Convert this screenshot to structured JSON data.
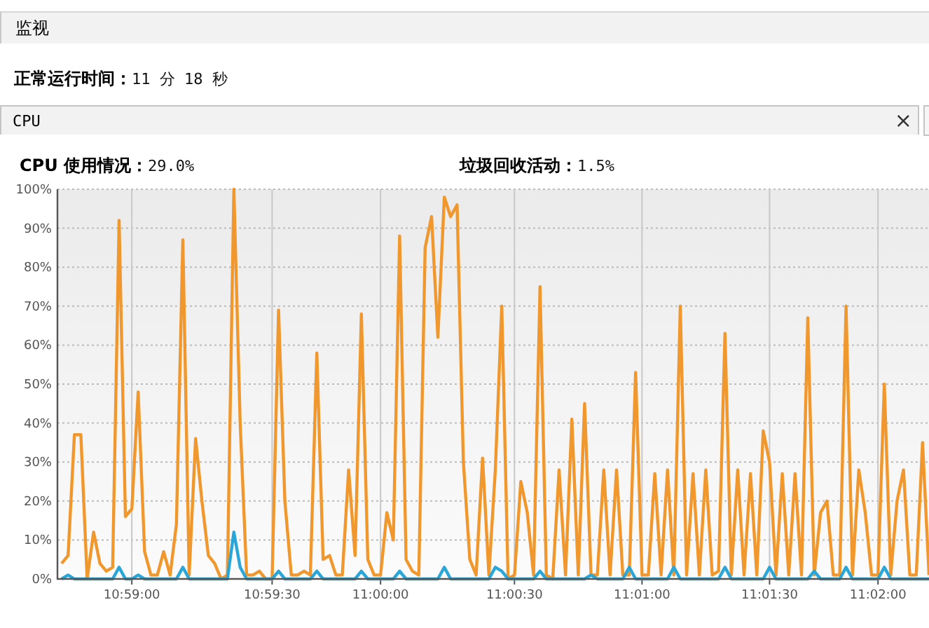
{
  "section_header": {
    "title": "监视"
  },
  "uptime": {
    "label": "正常运行时间：",
    "value": "11 分 18 秒"
  },
  "cpu_panel": {
    "title": "CPU",
    "close_glyph": "×",
    "cpu_usage": {
      "label": "CPU 使用情况：",
      "value": "29.0%"
    },
    "gc_activity": {
      "label": "垃圾回收活动：",
      "value": "1.5%"
    },
    "chart_data": {
      "type": "line",
      "grid": true,
      "ylim": [
        0,
        100
      ],
      "yticks": [
        {
          "value": 0,
          "label": "0%"
        },
        {
          "value": 10,
          "label": "10%"
        },
        {
          "value": 20,
          "label": "20%"
        },
        {
          "value": 30,
          "label": "30%"
        },
        {
          "value": 40,
          "label": "40%"
        },
        {
          "value": 50,
          "label": "50%"
        },
        {
          "value": 60,
          "label": "60%"
        },
        {
          "value": 70,
          "label": "70%"
        },
        {
          "value": 80,
          "label": "80%"
        },
        {
          "value": 90,
          "label": "90%"
        },
        {
          "value": 100,
          "label": "100%"
        }
      ],
      "categories": [
        null,
        null,
        null,
        null,
        null,
        null,
        null,
        null,
        null,
        null,
        null,
        "10:59:00",
        null,
        null,
        null,
        null,
        null,
        null,
        null,
        null,
        null,
        null,
        null,
        null,
        null,
        null,
        null,
        null,
        null,
        null,
        null,
        null,
        null,
        "10:59:30",
        null,
        null,
        null,
        null,
        null,
        null,
        null,
        null,
        null,
        null,
        null,
        null,
        null,
        null,
        null,
        null,
        "11:00:00",
        null,
        null,
        null,
        null,
        null,
        null,
        null,
        null,
        null,
        null,
        null,
        null,
        null,
        null,
        null,
        null,
        null,
        null,
        null,
        null,
        "11:00:30",
        null,
        null,
        null,
        null,
        null,
        null,
        null,
        null,
        null,
        null,
        null,
        null,
        null,
        null,
        null,
        null,
        null,
        null,
        null,
        "11:01:00",
        null,
        null,
        null,
        null,
        null,
        null,
        null,
        null,
        null,
        null,
        null,
        null,
        null,
        null,
        null,
        null,
        null,
        null,
        null,
        "11:01:30",
        null,
        null,
        null,
        null,
        null,
        null,
        null,
        null,
        null,
        null,
        null,
        null,
        null,
        null,
        null,
        null,
        "11:02:00",
        null,
        null,
        null,
        null,
        null,
        null,
        null,
        null
      ],
      "series": [
        {
          "color": "#f0982d",
          "values": [
            4,
            6,
            37,
            37,
            0,
            12,
            4,
            2,
            3,
            92,
            16,
            18,
            48,
            7,
            1,
            1,
            7,
            1,
            14,
            87,
            1,
            36,
            20,
            6,
            4,
            0,
            1,
            100,
            40,
            1,
            1,
            2,
            0,
            0,
            69,
            20,
            1,
            1,
            2,
            1,
            58,
            5,
            6,
            1,
            1,
            28,
            6,
            68,
            5,
            1,
            1,
            17,
            10,
            88,
            5,
            2,
            1,
            85,
            93,
            62,
            98,
            93,
            96,
            30,
            5,
            1,
            31,
            1,
            28,
            70,
            0,
            1,
            25,
            17,
            1,
            75,
            1,
            0,
            28,
            1,
            41,
            1,
            45,
            1,
            1,
            28,
            1,
            28,
            1,
            1,
            53,
            1,
            1,
            27,
            1,
            28,
            1,
            70,
            1,
            27,
            1,
            28,
            1,
            2,
            63,
            1,
            28,
            1,
            27,
            1,
            38,
            30,
            1,
            27,
            1,
            27,
            1,
            67,
            1,
            17,
            20,
            1,
            1,
            70,
            1,
            28,
            17,
            1,
            1,
            50,
            1,
            20,
            28,
            1,
            1,
            35,
            1
          ]
        },
        {
          "color": "#2aa7d8",
          "values": [
            0,
            1,
            0,
            0,
            0,
            0,
            0,
            0,
            0,
            3,
            0,
            0,
            1,
            0,
            0,
            0,
            0,
            0,
            0,
            3,
            0,
            0,
            0,
            0,
            0,
            0,
            0,
            12,
            3,
            0,
            0,
            0,
            0,
            0,
            2,
            0,
            0,
            0,
            0,
            0,
            2,
            0,
            0,
            0,
            0,
            0,
            0,
            2,
            0,
            0,
            0,
            0,
            0,
            2,
            0,
            0,
            0,
            0,
            0,
            0,
            3,
            0,
            0,
            0,
            0,
            0,
            0,
            0,
            3,
            2,
            0,
            0,
            0,
            0,
            0,
            2,
            0,
            0,
            0,
            0,
            0,
            0,
            0,
            1,
            0,
            0,
            0,
            0,
            0,
            3,
            0,
            0,
            0,
            0,
            0,
            0,
            3,
            0,
            0,
            0,
            0,
            0,
            0,
            0,
            3,
            0,
            0,
            0,
            0,
            0,
            0,
            3,
            0,
            0,
            0,
            0,
            0,
            0,
            2,
            0,
            0,
            0,
            0,
            3,
            0,
            0,
            0,
            0,
            0,
            3,
            0,
            0,
            0,
            0,
            0,
            0,
            0
          ]
        }
      ]
    }
  }
}
